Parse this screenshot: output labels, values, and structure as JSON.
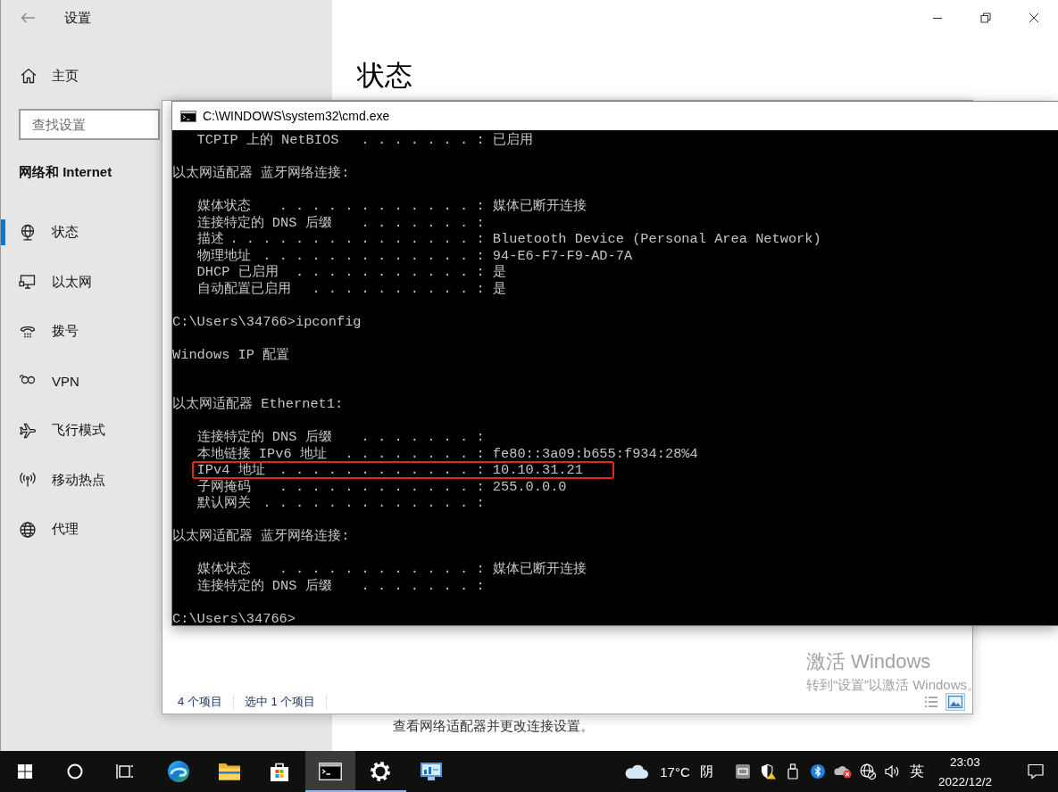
{
  "settings": {
    "title": "设置",
    "home": "主页",
    "search": {
      "placeholder": "查找设置"
    },
    "section": "网络和 Internet",
    "nav": [
      {
        "label": "状态",
        "selected": true
      },
      {
        "label": "以太网",
        "selected": false
      },
      {
        "label": "拨号",
        "selected": false
      },
      {
        "label": "VPN",
        "selected": false
      },
      {
        "label": "飞行模式",
        "selected": false
      },
      {
        "label": "移动热点",
        "selected": false
      },
      {
        "label": "代理",
        "selected": false
      }
    ],
    "page_title": "状态",
    "description": "查看网络适配器并更改连接设置。"
  },
  "explorer": {
    "status_bar": [
      "4 个项目",
      "选中 1 个项目"
    ],
    "view_buttons": [
      {
        "kind": "details",
        "selected": false
      },
      {
        "kind": "large_icons",
        "selected": true
      }
    ]
  },
  "cmd": {
    "title": "C:\\WINDOWS\\system32\\cmd.exe",
    "lines": [
      {
        "kind": "kv",
        "label": "TCPIP 上的 NetBIOS",
        "leader": ". . . . . . . :",
        "value": "已启用"
      },
      {
        "kind": "blank"
      },
      {
        "kind": "text",
        "text": "以太网适配器 蓝牙网络连接:"
      },
      {
        "kind": "blank"
      },
      {
        "kind": "kv",
        "label": "媒体状态",
        "leader": ". . . . . . . . . . . . :",
        "value": "媒体已断开连接"
      },
      {
        "kind": "kv",
        "label": "连接特定的 DNS 后缀",
        "leader": ". . . . . . . :"
      },
      {
        "kind": "kv",
        "label": "描述",
        "leader": ". . . . . . . . . . . . . . . :",
        "value": "Bluetooth Device (Personal Area Network)"
      },
      {
        "kind": "kv",
        "label": "物理地址",
        "leader": ". . . . . . . . . . . . . :",
        "value": "94-E6-F7-F9-AD-7A"
      },
      {
        "kind": "kv",
        "label": "DHCP 已启用",
        "leader": ". . . . . . . . . . . :",
        "value": "是"
      },
      {
        "kind": "kv",
        "label": "自动配置已启用",
        "leader": ". . . . . . . . . . :",
        "value": "是"
      },
      {
        "kind": "blank"
      },
      {
        "kind": "text",
        "text": "C:\\Users\\34766>ipconfig"
      },
      {
        "kind": "blank"
      },
      {
        "kind": "text",
        "text": "Windows IP 配置"
      },
      {
        "kind": "blank"
      },
      {
        "kind": "blank"
      },
      {
        "kind": "text",
        "text": "以太网适配器 Ethernet1:"
      },
      {
        "kind": "blank"
      },
      {
        "kind": "kv",
        "label": "连接特定的 DNS 后缀",
        "leader": ". . . . . . . :"
      },
      {
        "kind": "kv",
        "label": "本地链接 IPv6 地址",
        "leader": ". . . . . . . . :",
        "value": "fe80::3a09:b655:f934:28%4"
      },
      {
        "kind": "kv",
        "label": "IPv4 地址",
        "leader": ". . . . . . . . . . . . :",
        "value": "10.10.31.21"
      },
      {
        "kind": "kv",
        "label": "子网掩码",
        "leader": ". . . . . . . . . . . . :",
        "value": "255.0.0.0"
      },
      {
        "kind": "kv",
        "label": "默认网关",
        "leader": ". . . . . . . . . . . . . :"
      },
      {
        "kind": "blank"
      },
      {
        "kind": "text",
        "text": "以太网适配器 蓝牙网络连接:"
      },
      {
        "kind": "blank"
      },
      {
        "kind": "kv",
        "label": "媒体状态",
        "leader": ". . . . . . . . . . . . :",
        "value": "媒体已断开连接"
      },
      {
        "kind": "kv",
        "label": "连接特定的 DNS 后缀",
        "leader": ". . . . . . . :"
      },
      {
        "kind": "blank"
      },
      {
        "kind": "text",
        "text": "C:\\Users\\34766>"
      }
    ]
  },
  "activation_notice": {
    "title": "激活 Windows",
    "text": "转到“设置”以激活 Windows。"
  },
  "taskbar": {
    "apps": [
      {
        "running": false,
        "selected": false
      },
      {
        "running": false,
        "selected": false
      },
      {
        "running": false,
        "selected": false
      },
      {
        "running": true,
        "selected": true
      },
      {
        "running": true,
        "selected": false
      },
      {
        "running": false,
        "selected": false
      }
    ],
    "weather": {
      "temperature": "17°C",
      "condition": "阴"
    },
    "input_method": "英",
    "time": "23:03",
    "date": "2022/12/2"
  }
}
